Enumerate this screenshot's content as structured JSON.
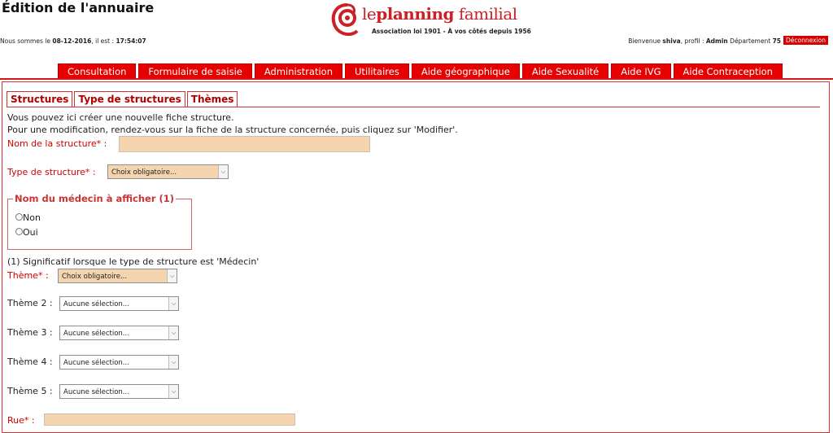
{
  "header": {
    "title": "Édition de l'annuaire",
    "date_prefix": "Nous sommes le",
    "date_value": "08-12-2016",
    "time_prefix": ", il est :",
    "time_value": "17:54:07",
    "welcome_prefix": "Bienvenue",
    "user": "shiva",
    "profile_prefix": ", profil :",
    "profile": "Admin",
    "dept_prefix": "Département",
    "dept": "75",
    "logout": "Déconnexion"
  },
  "logo": {
    "le": "le",
    "planning": "planning",
    "familial": "familial",
    "subtitle": "Association loi 1901 - À vos côtés depuis 1956"
  },
  "nav": {
    "items": [
      "Consultation",
      "Formulaire de saisie",
      "Administration",
      "Utilitaires",
      "Aide géographique",
      "Aide Sexualité",
      "Aide IVG",
      "Aide Contraception"
    ]
  },
  "tabs": [
    "Structures",
    "Type de structures",
    "Thèmes"
  ],
  "form": {
    "intro1": "Vous pouvez ici créer une nouvelle fiche structure.",
    "intro2": "Pour une modification, rendez-vous sur la fiche de la structure concernée, puis cliquez sur 'Modifier'.",
    "nom_label": "Nom de la structure* :",
    "nom_value": "",
    "type_label": "Type de structure* :",
    "type_select": "Choix obligatoire...",
    "medecin_legend": "Nom du médecin à afficher (1)",
    "radio_non": "Non",
    "radio_oui": "Oui",
    "note": "(1) Significatif lorsque le type de structure est 'Médecin'",
    "theme_label": "Thème* :",
    "theme_select": "Choix obligatoire...",
    "theme2_label": "Thème 2 :",
    "theme3_label": "Thème 3 :",
    "theme4_label": "Thème 4 :",
    "theme5_label": "Thème 5 :",
    "aucune": "Aucune sélection...",
    "rue_label": "Rue* :"
  }
}
